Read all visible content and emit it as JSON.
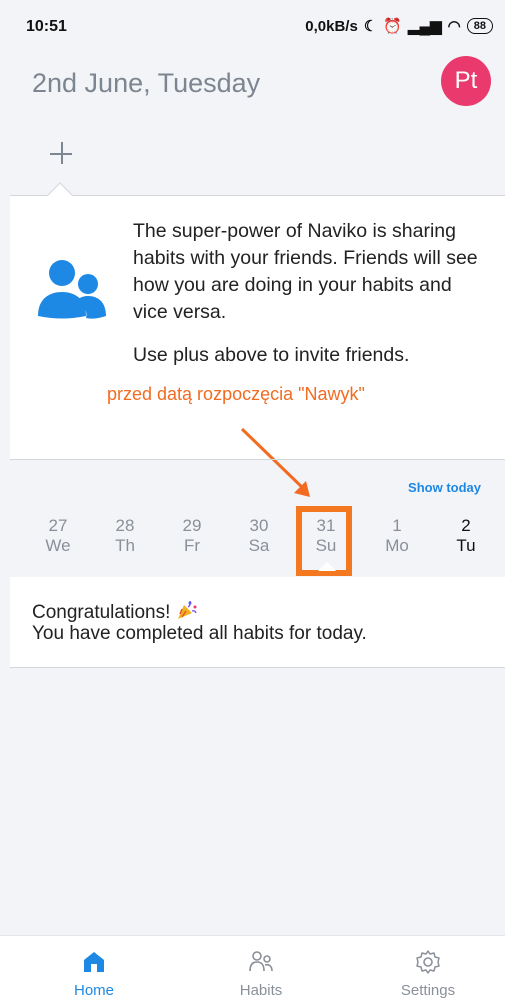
{
  "status_bar": {
    "time": "10:51",
    "network_speed": "0,0kB/s",
    "battery": "88"
  },
  "header": {
    "title": "2nd June, Tuesday",
    "avatar_initials": "Pt"
  },
  "friends_card": {
    "text_1": "The super-power of Naviko is sharing habits with your friends. Friends will see how you are doing in your habits and vice versa.",
    "text_2": "Use plus above to invite friends.",
    "annotation": "przed datą rozpoczęcia \"Nawyk\""
  },
  "days": {
    "show_today": "Show today",
    "items": [
      {
        "num": "27",
        "wd": "We"
      },
      {
        "num": "28",
        "wd": "Th"
      },
      {
        "num": "29",
        "wd": "Fr"
      },
      {
        "num": "30",
        "wd": "Sa"
      },
      {
        "num": "31",
        "wd": "Su"
      },
      {
        "num": "1",
        "wd": "Mo"
      },
      {
        "num": "2",
        "wd": "Tu"
      }
    ]
  },
  "congrats": {
    "line1": "Congratulations!",
    "line2": "You have completed all habits for today."
  },
  "nav": {
    "home": "Home",
    "habits": "Habits",
    "settings": "Settings"
  },
  "colors": {
    "accent": "#1e88e5",
    "avatar": "#ea3a6d",
    "annotation": "#f26b21"
  }
}
